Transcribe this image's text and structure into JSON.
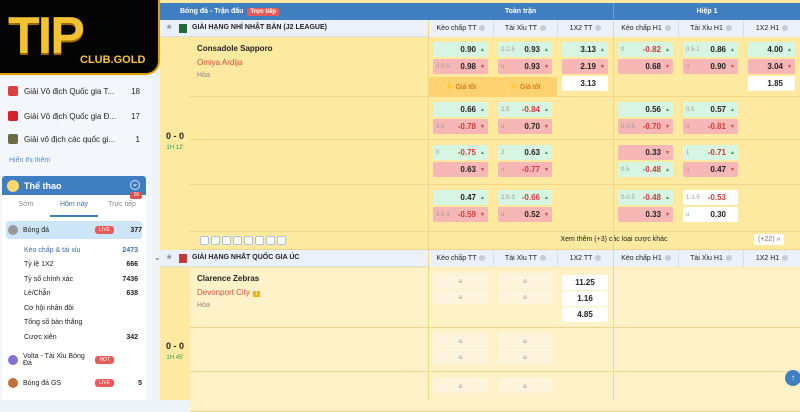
{
  "logo": {
    "text": "TIP",
    "sub": "CLUB.GOLD"
  },
  "sidebar": {
    "leagues": [
      {
        "name": "Giải Vô địch Quốc gia T...",
        "count": "18",
        "color": "#d94040"
      },
      {
        "name": "Giải Vô địch Quốc gia Đ...",
        "count": "17",
        "color": "#d3202a"
      },
      {
        "name": "Giải vô địch các quốc gi...",
        "count": "1",
        "color": "#6b6b4a"
      }
    ],
    "show_more": "Hiển thị thêm",
    "sport_title": "Thể thao",
    "tabs": [
      "Sớm",
      "Hôm nay",
      "Trực tiếp"
    ],
    "tab_badge": "26",
    "football": {
      "name": "Bóng đá",
      "badge": "LIVE",
      "count": "377"
    },
    "subs": [
      {
        "name": "Kèo chấp & tài xỉu",
        "count": "2473"
      },
      {
        "name": "Tỷ lệ 1X2",
        "count": "666"
      },
      {
        "name": "Tỷ số chính xác",
        "count": "7436"
      },
      {
        "name": "Lẻ/Chẵn",
        "count": "638"
      },
      {
        "name": "Cơ hội nhân đôi",
        "count": ""
      },
      {
        "name": "Tổng số bàn thắng",
        "count": ""
      },
      {
        "name": "Cược xiên",
        "count": "342"
      }
    ],
    "volta": {
      "name": "Volta - Tài Xỉu Bóng Đá",
      "badge": "HOT"
    },
    "gs": {
      "name": "Bóng đá GS",
      "badge": "LIVE",
      "count": "5"
    }
  },
  "main": {
    "title": "Bóng đá - Trận đấu",
    "live_badge": "Trực tiếp",
    "full_time": "Toàn trận",
    "half": "Hiệp 1",
    "columns": [
      "Kèo chấp TT",
      "Tài Xỉu TT",
      "1X2 TT",
      "Kèo chấp H1",
      "Tài Xỉu H1",
      "1X2 H1"
    ],
    "best_price": "⚡ Giá tốt",
    "more_bets": "Xem thêm (+3) các loại cược khác",
    "more_count": "(+22) »",
    "matches": [
      {
        "league": "GIẢI HẠNG NHÌ NHẬT BẢN (J2 LEAGUE)",
        "home": "Consadole Sapporo",
        "away": "Omiya Ardija",
        "draw": "Hòa",
        "score": "0 - 0",
        "time": "1H 12'",
        "rows": [
          [
            [
              [
                "",
                "0.90",
                "up",
                "g"
              ],
              [
                "0-0.5",
                "0.98",
                "down",
                "r"
              ]
            ],
            [
              [
                "2-2.5",
                "0.93",
                "up",
                "g"
              ],
              [
                "u",
                "0.93",
                "down",
                "r"
              ]
            ],
            [
              [
                "",
                "3.13",
                "up",
                "g"
              ],
              [
                "",
                "2.19",
                "down",
                "r"
              ],
              [
                "",
                "3.13",
                "",
                "w"
              ]
            ],
            [
              [
                "0",
                "-0.82",
                "up",
                "g"
              ],
              [
                "",
                "0.68",
                "down",
                "r"
              ]
            ],
            [
              [
                "0.5-1",
                "0.86",
                "up",
                "g"
              ],
              [
                "u",
                "0.90",
                "down",
                "r"
              ]
            ],
            [
              [
                "",
                "4.00",
                "up",
                "g"
              ],
              [
                "",
                "3.04",
                "down",
                "r"
              ],
              [
                "",
                "1.85",
                "",
                "w"
              ]
            ]
          ],
          [
            [
              [
                "",
                "0.66",
                "up",
                "g"
              ],
              [
                "0.5",
                "-0.78",
                "down",
                "r"
              ]
            ],
            [
              [
                "2.5",
                "-0.84",
                "up",
                "g"
              ],
              [
                "u",
                "0.70",
                "down",
                "r"
              ]
            ],
            [],
            [
              [
                "",
                "0.56",
                "up",
                "g"
              ],
              [
                "0-0.5",
                "-0.70",
                "down",
                "r"
              ]
            ],
            [
              [
                "0.5",
                "0.57",
                "up",
                "g"
              ],
              [
                "u",
                "-0.81",
                "down",
                "r"
              ]
            ],
            []
          ],
          [
            [
              [
                "0",
                "-0.75",
                "up",
                "g"
              ],
              [
                "",
                "0.63",
                "down",
                "r"
              ]
            ],
            [
              [
                "2",
                "0.63",
                "up",
                "g"
              ],
              [
                "u",
                "-0.77",
                "down",
                "r"
              ]
            ],
            [],
            [
              [
                "",
                "0.33",
                "down",
                "r"
              ],
              [
                "0.5",
                "-0.48",
                "up",
                "g"
              ]
            ],
            [
              [
                "1",
                "-0.71",
                "up",
                "g"
              ],
              [
                "u",
                "0.47",
                "down",
                "r"
              ]
            ],
            []
          ],
          [
            [
              [
                "",
                "0.47",
                "up",
                "g"
              ],
              [
                "0.5-1",
                "-0.59",
                "down",
                "r"
              ]
            ],
            [
              [
                "2.5-3",
                "-0.66",
                "up",
                "g"
              ],
              [
                "u",
                "0.52",
                "down",
                "r"
              ]
            ],
            [],
            [
              [
                "0-0.5",
                "-0.48",
                "up",
                "g"
              ],
              [
                "",
                "0.33",
                "down",
                "r"
              ]
            ],
            [
              [
                "1-1.5",
                "-0.53",
                "",
                "w"
              ],
              [
                "u",
                "0.30",
                "",
                "w"
              ]
            ],
            []
          ]
        ]
      },
      {
        "league": "GIẢI HẠNG NHẤT QUỐC GIA ÚC",
        "home": "Clarence Zebras",
        "away": "Devonport City",
        "away_card": "1",
        "draw": "Hòa",
        "score": "0 - 0",
        "time": "1H 45'",
        "x12": [
          "11.25",
          "1.16",
          "4.85"
        ]
      }
    ]
  },
  "colors": {
    "accent": "#3f7fc1",
    "row_bg": "#fde9a0",
    "up": "#d7f5e3",
    "down": "#f7b7b7",
    "live": "#e85a5a"
  }
}
